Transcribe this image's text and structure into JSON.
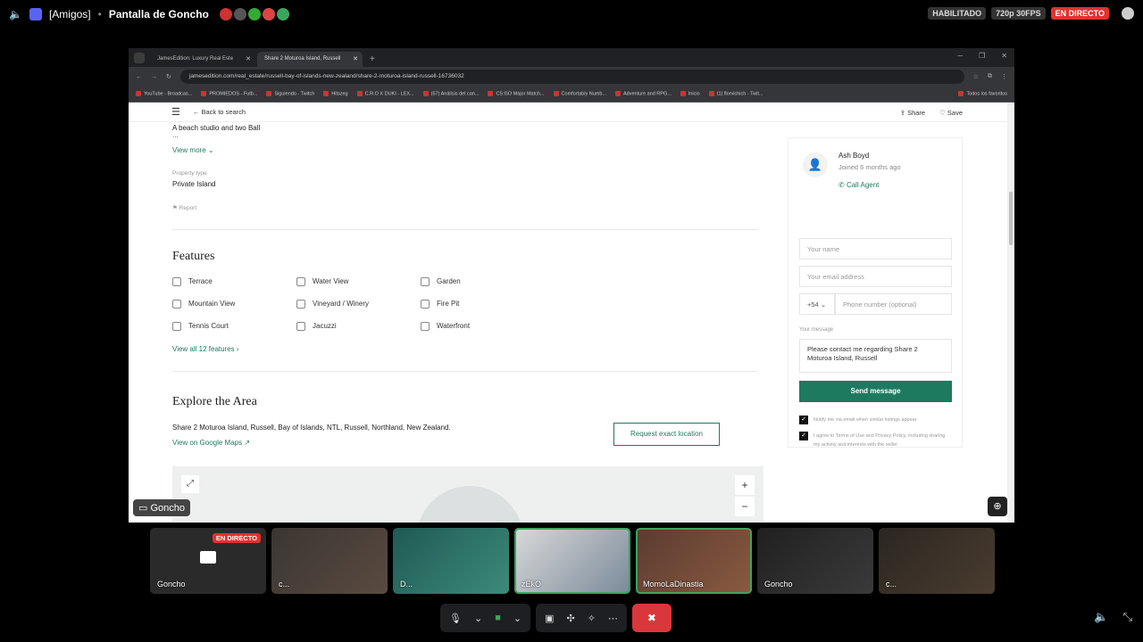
{
  "stream": {
    "channel": "[Amigos]",
    "title": "Pantalla de Goncho",
    "enabled": "HABILITADO",
    "quality": "720p 30FPS",
    "live": "EN DIRECTO"
  },
  "browser": {
    "tabs": [
      {
        "label": "JamesEdition: Luxury Real Este"
      },
      {
        "label": "Share 2 Moturoa Island, Russell"
      }
    ],
    "url": "jamesedition.com/real_estate/russell-bay-of-islands-new-zealand/share-2-moturoa-island-russell-16736032",
    "bookmarks": [
      "YouTube - Broadcas...",
      "PROMIEDOS - Futb...",
      "Siguiendo - Twitch",
      "Hitszeg",
      "C.R.O X DUKI - LEX...",
      "(57) Análisis del can...",
      "CS:GO Major Match...",
      "Comfortably Numb...",
      "Adventure and RPG...",
      "Inicio",
      "(1) florvichich - Twit..."
    ],
    "bookmarks_right": "Todos los favoritos"
  },
  "page": {
    "back": "Back to search",
    "share": "Share",
    "save": "Save",
    "desc": "A beach studio and two Ball",
    "ellipsis": "...",
    "view_more": "View more",
    "ptype_label": "Property type",
    "ptype_value": "Private Island",
    "report": "Report",
    "features_title": "Features",
    "features": [
      "Terrace",
      "Water View",
      "Garden",
      "Mountain View",
      "Vineyard / Winery",
      "Fire Pit",
      "Tennis Court",
      "Jacuzzi",
      "Waterfront"
    ],
    "view_all": "View all 12 features",
    "area_title": "Explore the Area",
    "address": "Share 2 Moturoa Island, Russell, Bay of Islands, NTL, Russell, Northland, New Zealand.",
    "gmaps": "View on Google Maps",
    "request": "Request exact location"
  },
  "agent": {
    "name": "Ash Boyd",
    "joined": "Joined 6 months ago",
    "call": "Call Agent",
    "name_ph": "Your name",
    "email_ph": "Your email address",
    "code": "+54",
    "phone_ph": "Phone number (optional)",
    "msg_label": "Your message",
    "msg": "Please contact me regarding Share 2 Moturoa Island, Russell",
    "send": "Send message",
    "chk1": "Notify me via email when similar listings appear",
    "chk2": "I agree to Terms of Use and Privacy Policy, including sharing my activity and interests with the seller"
  },
  "nametag": "Goncho",
  "participants": [
    {
      "name": "Goncho",
      "live": "EN DIRECTO"
    },
    {
      "name": "c..."
    },
    {
      "name": "D..."
    },
    {
      "name": "zEkO"
    },
    {
      "name": "MomoLaDinastia"
    },
    {
      "name": "Goncho"
    },
    {
      "name": "c..."
    }
  ]
}
